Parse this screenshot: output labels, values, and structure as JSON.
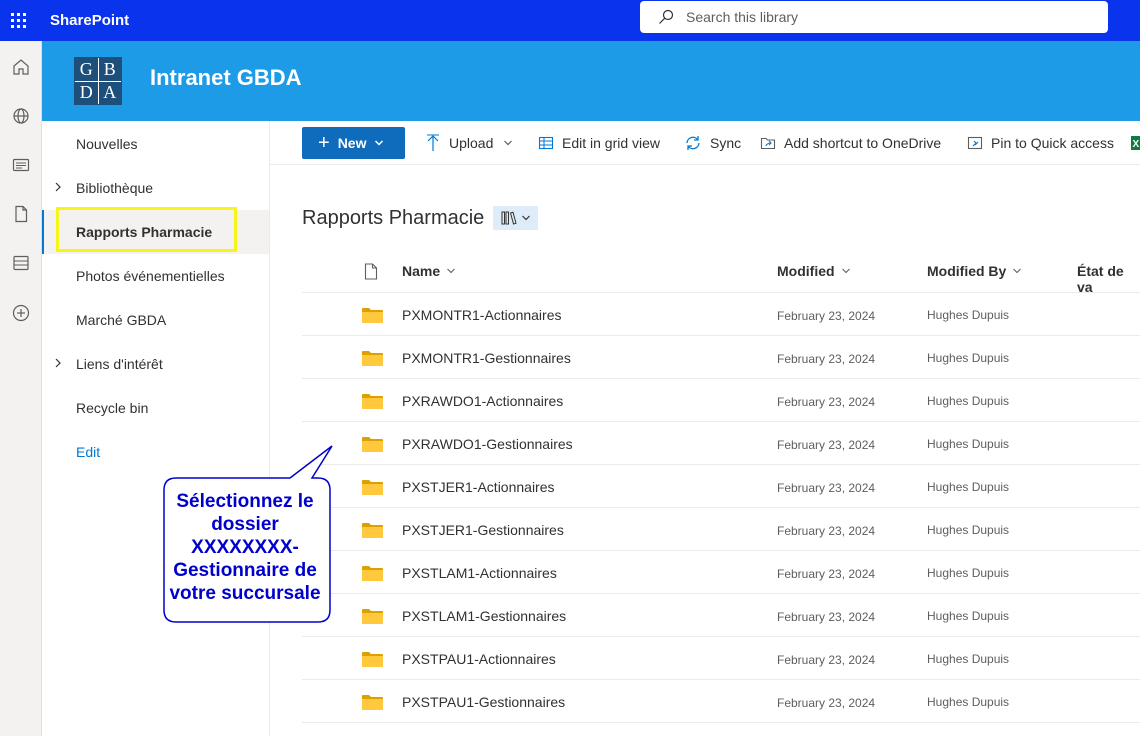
{
  "suite": {
    "app_name": "SharePoint",
    "search_placeholder": "Search this library"
  },
  "site": {
    "logo_letters": [
      "G",
      "B",
      "D",
      "A"
    ],
    "title": "Intranet GBDA",
    "header_color": "#1d9be6"
  },
  "rail": {
    "icons": [
      "home-icon",
      "globe-icon",
      "news-icon",
      "file-icon",
      "list-icon",
      "add-icon"
    ]
  },
  "nav": {
    "items": [
      {
        "label": "Nouvelles"
      },
      {
        "label": "Bibliothèque"
      },
      {
        "label": "Rapports Pharmacie"
      },
      {
        "label": "Photos événementielles"
      },
      {
        "label": "Marché GBDA"
      },
      {
        "label": "Liens d'intérêt"
      },
      {
        "label": "Recycle bin"
      },
      {
        "label": "Edit"
      }
    ]
  },
  "commands": {
    "new": "New",
    "upload": "Upload",
    "grid": "Edit in grid view",
    "sync": "Sync",
    "shortcut": "Add shortcut to OneDrive",
    "pin": "Pin to Quick access"
  },
  "library": {
    "title": "Rapports Pharmacie",
    "columns": {
      "name": "Name",
      "modified": "Modified",
      "modified_by": "Modified By",
      "state": "État de va"
    },
    "rows": [
      {
        "name": "PXMONTR1-Actionnaires",
        "modified": "February 23, 2024",
        "by": "Hughes Dupuis"
      },
      {
        "name": "PXMONTR1-Gestionnaires",
        "modified": "February 23, 2024",
        "by": "Hughes Dupuis"
      },
      {
        "name": "PXRAWDO1-Actionnaires",
        "modified": "February 23, 2024",
        "by": "Hughes Dupuis"
      },
      {
        "name": "PXRAWDO1-Gestionnaires",
        "modified": "February 23, 2024",
        "by": "Hughes Dupuis"
      },
      {
        "name": "PXSTJER1-Actionnaires",
        "modified": "February 23, 2024",
        "by": "Hughes Dupuis"
      },
      {
        "name": "PXSTJER1-Gestionnaires",
        "modified": "February 23, 2024",
        "by": "Hughes Dupuis"
      },
      {
        "name": "PXSTLAM1-Actionnaires",
        "modified": "February 23, 2024",
        "by": "Hughes Dupuis"
      },
      {
        "name": "PXSTLAM1-Gestionnaires",
        "modified": "February 23, 2024",
        "by": "Hughes Dupuis"
      },
      {
        "name": "PXSTPAU1-Actionnaires",
        "modified": "February 23, 2024",
        "by": "Hughes Dupuis"
      },
      {
        "name": "PXSTPAU1-Gestionnaires",
        "modified": "February 23, 2024",
        "by": "Hughes Dupuis"
      }
    ]
  },
  "callout": {
    "lines": [
      "Sélectionnez le",
      "dossier",
      "XXXXXXXX-",
      "Gestionnaire de",
      "votre succursale"
    ]
  }
}
